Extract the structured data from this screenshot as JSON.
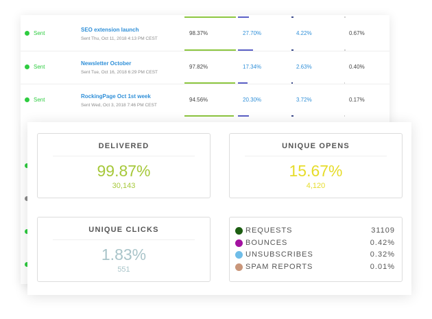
{
  "campaigns": [
    {
      "status": "Sent",
      "title": "SEO extension launch",
      "subtitle": "Sent Thu, Oct 11, 2018 4:13 PM CEST",
      "delivered": "98.37%",
      "opens": "27.70%",
      "clicks": "4.22%",
      "other": "0.67%"
    },
    {
      "status": "Sent",
      "title": "Newsletter October",
      "subtitle": "Sent Tue, Oct 16, 2018 6:29 PM CEST",
      "delivered": "97.82%",
      "opens": "17.34%",
      "clicks": "2.63%",
      "other": "0.40%"
    },
    {
      "status": "Sent",
      "title": "RockingPage Oct 1st week",
      "subtitle": "Sent Wed, Oct 3, 2018 7:46 PM CEST",
      "delivered": "94.56%",
      "opens": "20.30%",
      "clicks": "3.72%",
      "other": "0.17%"
    }
  ],
  "stats": {
    "delivered": {
      "label": "DELIVERED",
      "percent": "99.87%",
      "count": "30,143",
      "color": "#a6c83a"
    },
    "unique_opens": {
      "label": "UNIQUE OPENS",
      "percent": "15.67%",
      "count": "4,120",
      "color": "#e6dc2a"
    },
    "unique_clicks": {
      "label": "UNIQUE CLICKS",
      "percent": "1.83%",
      "count": "551",
      "color": "#a9c4c9"
    }
  },
  "legend": [
    {
      "name": "REQUESTS",
      "value": "31109",
      "color": "#1d5e12"
    },
    {
      "name": "BOUNCES",
      "value": "0.42%",
      "color": "#a312a0"
    },
    {
      "name": "UNSUBSCRIBES",
      "value": "0.32%",
      "color": "#6fbde8"
    },
    {
      "name": "SPAM REPORTS",
      "value": "0.01%",
      "color": "#c9967a"
    }
  ],
  "colors": {
    "sent": "#2ecc40",
    "link": "#2f8fd8"
  }
}
